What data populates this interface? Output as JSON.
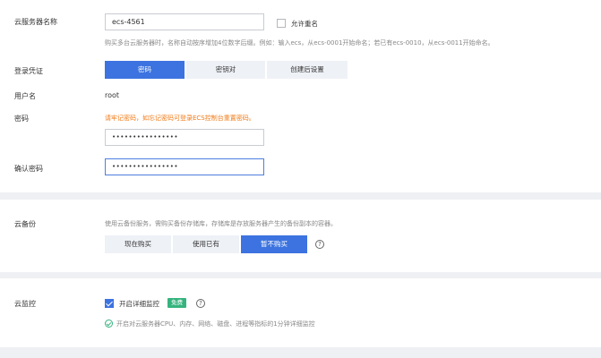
{
  "server_name": {
    "label": "云服务器名称",
    "value": "ecs-4561",
    "allow_duplicate_label": "允许重名",
    "hint": "购买多台云服务器时，名称自动按序增加4位数字后缀。例如：输入ecs，从ecs-0001开始命名；若已有ecs-0010，从ecs-0011开始命名。"
  },
  "login": {
    "label": "登录凭证",
    "options": [
      "密码",
      "密钥对",
      "创建后设置"
    ],
    "selected": "密码"
  },
  "username": {
    "label": "用户名",
    "value": "root"
  },
  "password": {
    "label": "密码",
    "warning": "请牢记密码，如忘记密码可登录ECS控制台重置密码。",
    "value": "••••••••••••••••"
  },
  "confirm_password": {
    "label": "确认密码",
    "value": "••••••••••••••••"
  },
  "backup": {
    "label": "云备份",
    "hint": "使用云备份服务，需购买备份存储库，存储库是存放服务器产生的备份副本的容器。",
    "options": [
      "现在购买",
      "使用已有",
      "暂不购买"
    ],
    "selected": "暂不购买"
  },
  "monitor": {
    "label": "云监控",
    "checkbox_label": "开启详细监控",
    "badge": "免费",
    "info": "开启对云服务器CPU、内存、网络、磁盘、进程等指标的1分钟详细监控"
  },
  "colors": {
    "accent": "#3c73e0",
    "warning": "#f07a16",
    "success": "#36b37e"
  }
}
